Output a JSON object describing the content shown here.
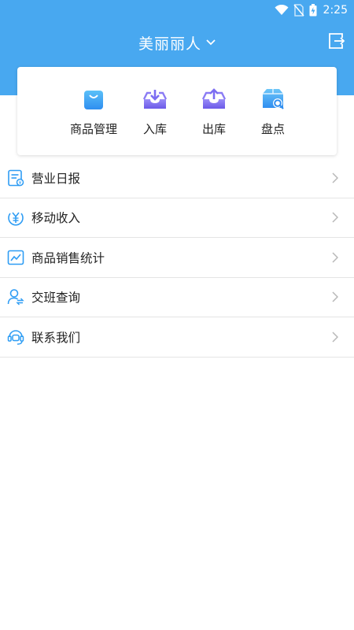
{
  "status_bar": {
    "time": "2:25"
  },
  "header": {
    "title": "美丽丽人"
  },
  "quick_actions": [
    {
      "label": "商品管理",
      "icon": "shopping-bag-icon"
    },
    {
      "label": "入库",
      "icon": "inbox-download-icon"
    },
    {
      "label": "出库",
      "icon": "inbox-upload-icon"
    },
    {
      "label": "盘点",
      "icon": "box-search-icon"
    }
  ],
  "menu": [
    {
      "label": "营业日报",
      "icon": "daily-report-icon"
    },
    {
      "label": "移动收入",
      "icon": "yuan-icon"
    },
    {
      "label": "商品销售统计",
      "icon": "line-chart-icon"
    },
    {
      "label": "交班查询",
      "icon": "user-exchange-icon"
    },
    {
      "label": "联系我们",
      "icon": "headset-icon"
    }
  ],
  "colors": {
    "primary": "#48a8f0",
    "accent_purple": "#7b6cf2",
    "icon_blue": "#2f9df4"
  }
}
